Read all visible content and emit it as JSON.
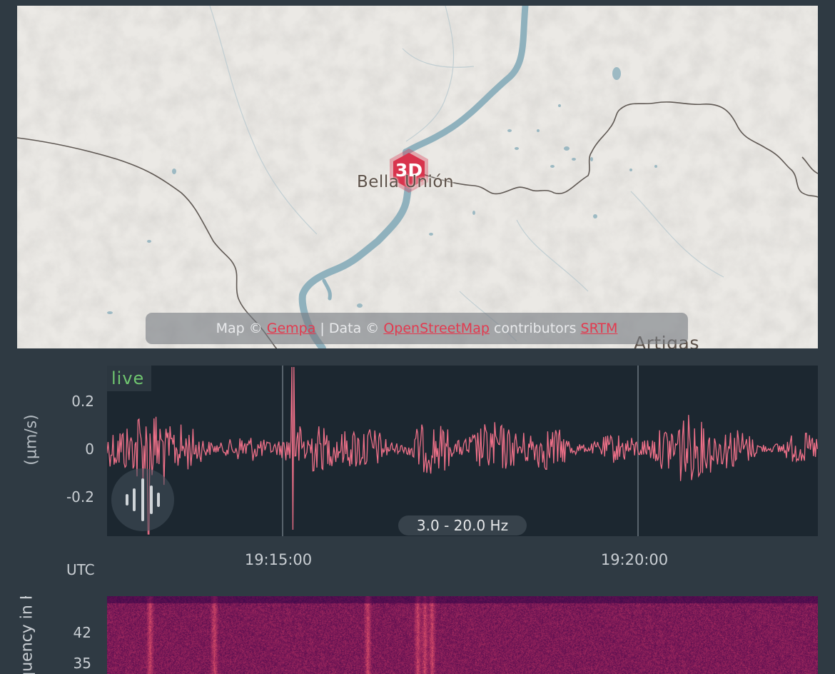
{
  "map": {
    "city": "Bella Unión",
    "city_secondary": "Artigas",
    "marker_label": "3D",
    "attribution": {
      "prefix": "Map ©",
      "map_link": "Gempa",
      "separator": "| Data ©",
      "data_link": "OpenStreetMap",
      "middle": "contributors",
      "srtm_link": "SRTM"
    },
    "colors": {
      "land": "#e8e6e2",
      "river": "#8fb1bd",
      "border": "#5f5853",
      "marker": "#d8344d"
    }
  },
  "waveform": {
    "live_label": "live",
    "filter_label": "3.0 - 20.0 Hz",
    "y_axis_label": "(µm/s)",
    "y_ticks": [
      "0.2",
      "0",
      "-0.2"
    ],
    "x_ticks": [
      "19:15:00",
      "19:20:00"
    ],
    "timezone_label": "UTC",
    "trace_color": "#ee7088",
    "audio_icon": "sound-wave-icon"
  },
  "spectrogram": {
    "y_axis_label": "Frequency in Hz",
    "y_ticks": [
      "42",
      "35"
    ]
  }
}
